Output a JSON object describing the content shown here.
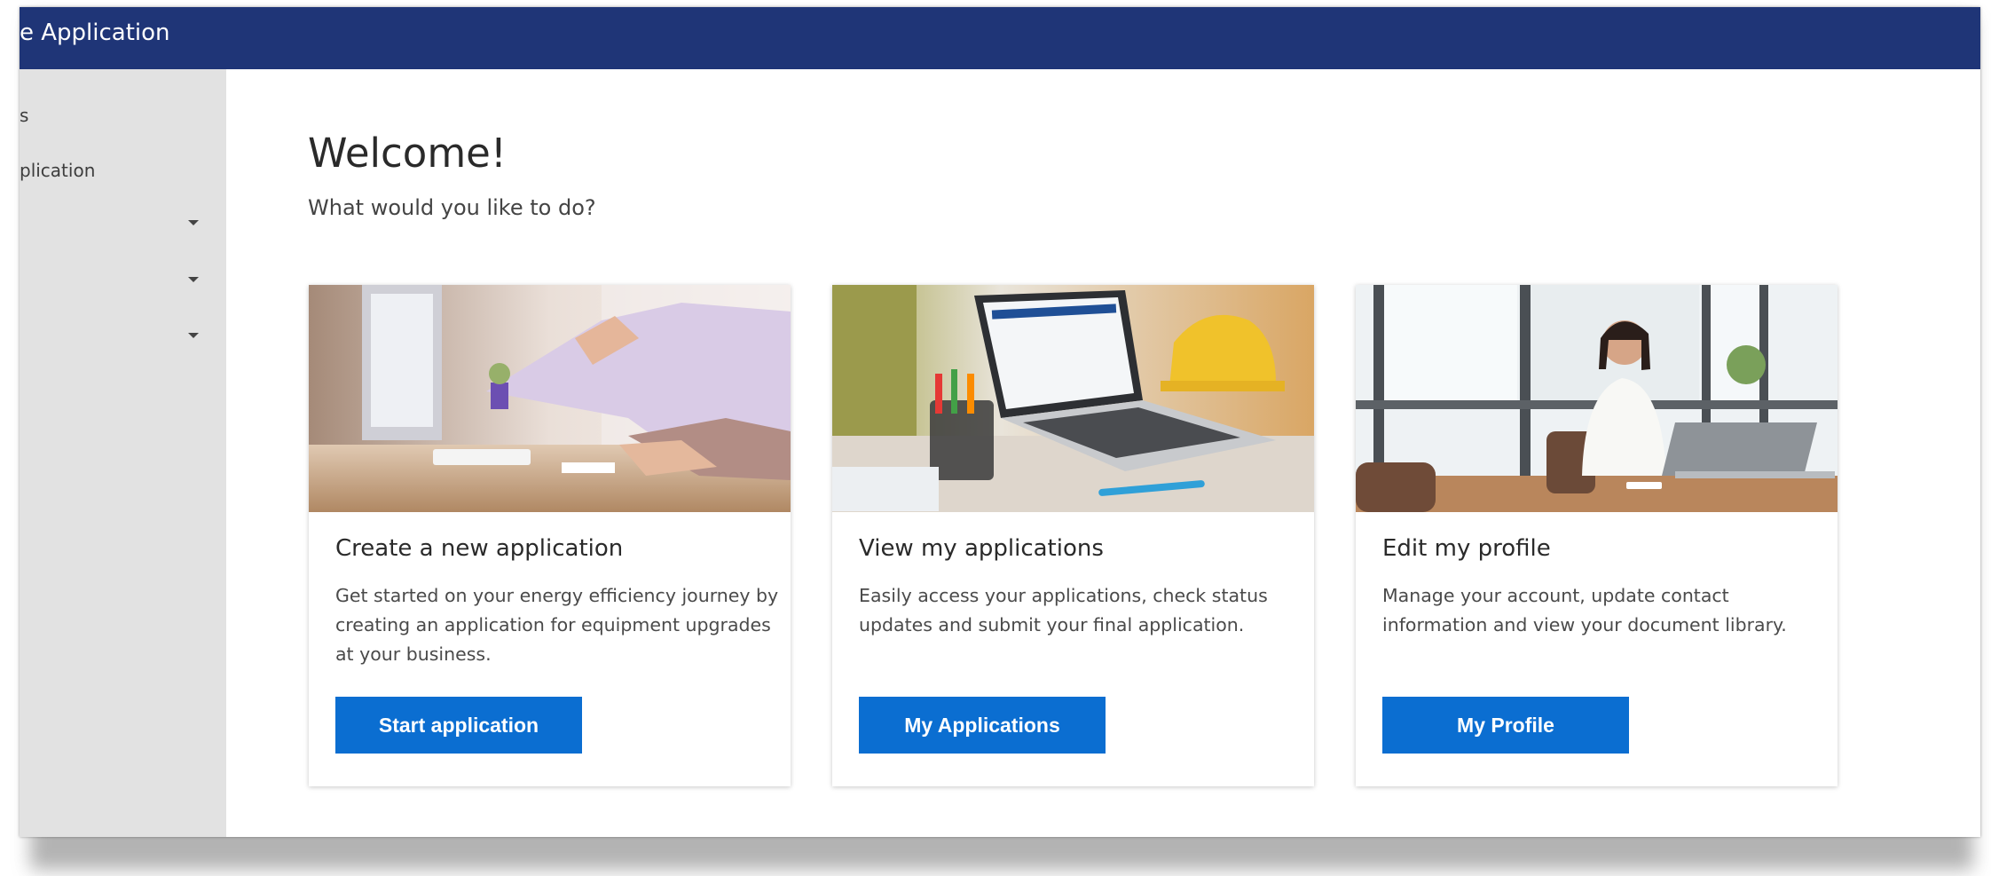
{
  "header": {
    "title": "e Application"
  },
  "sidebar": {
    "items": [
      {
        "label": "s"
      },
      {
        "label": "plication"
      },
      {
        "label": ""
      },
      {
        "label": ""
      },
      {
        "label": ""
      }
    ]
  },
  "main": {
    "heading": "Welcome!",
    "subheading": "What would you like to do?",
    "cards": [
      {
        "title": "Create a new application",
        "description": "Get started on your energy efficiency journey by creating an application for equipment upgrades at your business.",
        "button": "Start application"
      },
      {
        "title": "View my applications",
        "description": "Easily access your applications, check status updates and submit your final application.",
        "button": "My Applications"
      },
      {
        "title": "Edit my profile",
        "description": "Manage your account, update contact information and view your document library.",
        "button": "My Profile"
      }
    ]
  },
  "colors": {
    "header": "#1f3577",
    "sidebar": "#e2e2e2",
    "button": "#0b6ed1"
  },
  "icons": [
    "caret-down-icon"
  ]
}
